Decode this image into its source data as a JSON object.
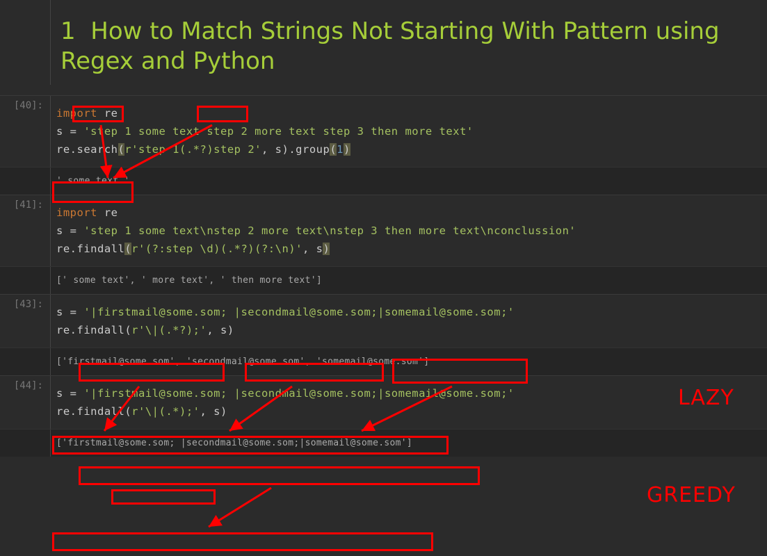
{
  "heading": {
    "number": "1",
    "title": "How to Match Strings Not Starting With Pattern using Regex and Python"
  },
  "cells": {
    "c40": {
      "prompt": "[40]:",
      "code": {
        "l1_kw": "import",
        "l1_mod": " re",
        "l2_var": "s",
        "l2_eq": " = ",
        "l2_str": "'step 1 some text step 2 more text step 3 then more text'",
        "l3_pre": "re.search",
        "l3_open": "(",
        "l3_arg1": "r'step 1(.*?)step 2'",
        "l3_comma": ", s",
        "l3_close": ")",
        "l3_group": ".group",
        "l3_g_open": "(",
        "l3_g_num": "1",
        "l3_g_close": ")"
      },
      "output": "' some text '"
    },
    "c41": {
      "prompt": "[41]:",
      "code": {
        "l1_kw": "import",
        "l1_mod": " re",
        "l2_var": "s",
        "l2_eq": " = ",
        "l2_str": "'step 1 some text\\nstep 2 more text\\nstep 3 then more text\\nconclussion'",
        "l3_pre": "re.findall",
        "l3_open": "(",
        "l3_arg1": "r'(?:step \\d)(.*?)(?:\\n)'",
        "l3_comma": ", s",
        "l3_close": ")"
      },
      "output": "[' some text', ' more text', ' then more text']"
    },
    "c43": {
      "prompt": "[43]:",
      "code": {
        "l1_var": "s",
        "l1_eq": " = ",
        "l1_str": "'|firstmail@some.som; |secondmail@some.som;|somemail@some.som;'",
        "l2_pre": "re.findall",
        "l2_open": "(",
        "l2_arg1": "r'\\|(.*?);'",
        "l2_comma": ", s",
        "l2_close": ")"
      },
      "output": "['firstmail@some.som', 'secondmail@some.som', 'somemail@some.som']",
      "label": "LAZY"
    },
    "c44": {
      "prompt": "[44]:",
      "code": {
        "l1_var": "s",
        "l1_eq": " = ",
        "l1_str": "'|firstmail@some.som; |secondmail@some.som;|somemail@some.som;'",
        "l2_pre": "re.findall",
        "l2_open": "(",
        "l2_arg1": "r'\\|(.*);'",
        "l2_comma": ", s",
        "l2_close": ")"
      },
      "output": "['firstmail@some.som; |secondmail@some.som;|somemail@some.som']",
      "label": "GREEDY"
    }
  }
}
